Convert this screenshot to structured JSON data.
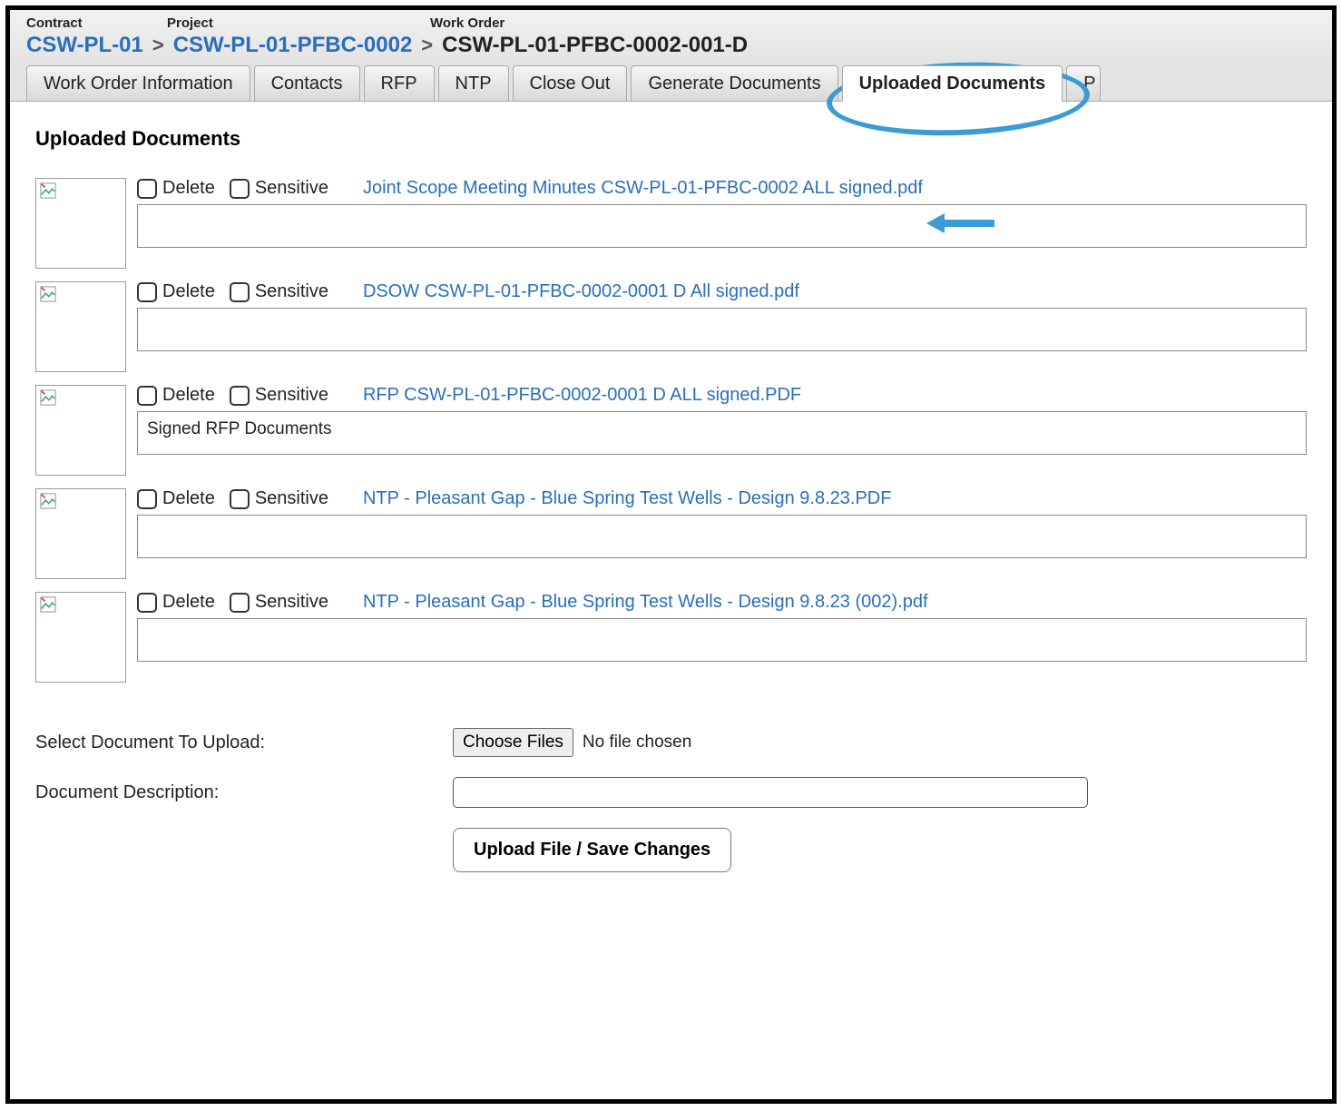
{
  "breadcrumb": {
    "labels": {
      "contract": "Contract",
      "project": "Project",
      "work_order": "Work Order"
    },
    "contract": "CSW-PL-01",
    "project": "CSW-PL-01-PFBC-0002",
    "work_order": "CSW-PL-01-PFBC-0002-001-D",
    "sep": ">"
  },
  "tabs": {
    "t0": "Work Order Information",
    "t1": "Contacts",
    "t2": "RFP",
    "t3": "NTP",
    "t4": "Close Out",
    "t5": "Generate Documents",
    "t6": "Uploaded Documents",
    "t7": "P"
  },
  "section": {
    "title": "Uploaded Documents"
  },
  "labels": {
    "delete": "Delete",
    "sensitive": "Sensitive",
    "select_doc": "Select Document To Upload:",
    "doc_desc": "Document Description:",
    "choose_files": "Choose Files",
    "no_file": "No file chosen",
    "upload_btn": "Upload File / Save Changes"
  },
  "documents": [
    {
      "name": "Joint Scope Meeting Minutes CSW-PL-01-PFBC-0002 ALL signed.pdf",
      "description": ""
    },
    {
      "name": "DSOW CSW-PL-01-PFBC-0002-0001 D All signed.pdf",
      "description": ""
    },
    {
      "name": "RFP CSW-PL-01-PFBC-0002-0001 D ALL signed.PDF",
      "description": "Signed RFP Documents"
    },
    {
      "name": "NTP - Pleasant Gap - Blue Spring Test Wells - Design 9.8.23.PDF",
      "description": ""
    },
    {
      "name": "NTP - Pleasant Gap - Blue Spring Test Wells - Design 9.8.23 (002).pdf",
      "description": ""
    }
  ]
}
